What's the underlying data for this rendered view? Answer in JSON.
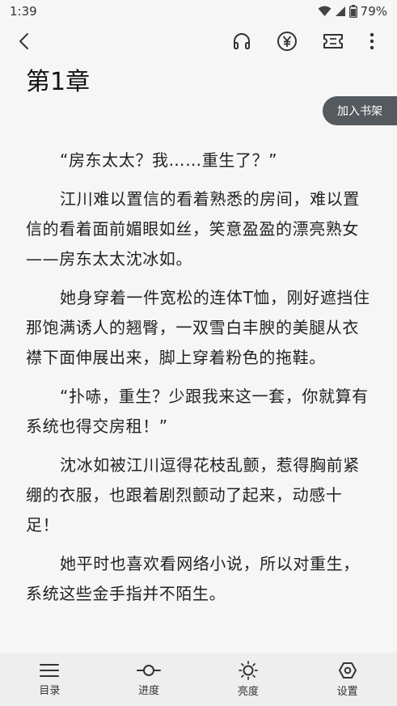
{
  "status": {
    "time": "1:39",
    "battery": "79%"
  },
  "toolbar": {
    "back_icon": "arrow-left-icon",
    "listen_icon": "headphones-icon",
    "reward_icon": "yen-circle-icon",
    "ticket_icon": "ticket-icon",
    "more_icon": "more-vertical-icon"
  },
  "chapter": {
    "title": "第1章"
  },
  "bookshelf": {
    "label": "加入书架"
  },
  "paragraphs": [
    "“房东太太？我……重生了？”",
    "江川难以置信的看着熟悉的房间，难以置信的看着面前媚眼如丝，笑意盈盈的漂亮熟女——房东太太沈冰如。",
    "她身穿着一件宽松的连体T恤，刚好遮挡住那饱满诱人的翘臀，一双雪白丰腴的美腿从衣襟下面伸展出来，脚上穿着粉色的拖鞋。",
    "“扑哧，重生？少跟我来这一套，你就算有系统也得交房租！”",
    "沈冰如被江川逗得花枝乱颤，惹得胸前紧绷的衣服，也跟着剧烈颤动了起来，动感十足！",
    "她平时也喜欢看网络小说，所以对重生，系统这些金手指并不陌生。"
  ],
  "bottom_nav": [
    {
      "label": "目录",
      "icon": "menu-icon"
    },
    {
      "label": "进度",
      "icon": "progress-icon"
    },
    {
      "label": "亮度",
      "icon": "brightness-icon"
    },
    {
      "label": "设置",
      "icon": "settings-icon"
    }
  ]
}
